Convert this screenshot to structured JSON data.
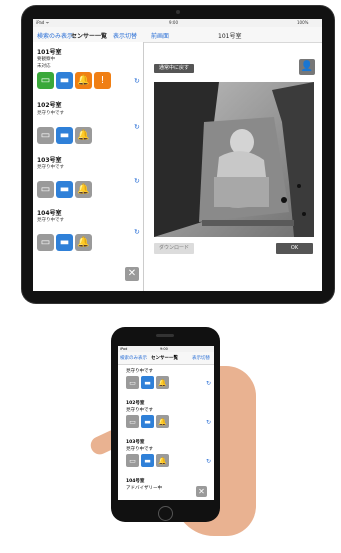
{
  "tablet": {
    "status_left": "iPad ᯤ",
    "status_time": "9:00",
    "status_right": "100%",
    "nav_left": "検索のみ表示",
    "nav_center": "センサー一覧",
    "nav_right": "表示切替",
    "nav_right2": "前画面",
    "detail_title": "101号室",
    "rooms": [
      {
        "name": "101号室",
        "line1": "要観察中",
        "line2": "未対応"
      },
      {
        "name": "102号室",
        "line1": "見守り中です"
      },
      {
        "name": "103号室",
        "line1": "見守り中です"
      },
      {
        "name": "104号室",
        "line1": "見守り中です"
      }
    ],
    "top_button": "通常中に戻す",
    "bottom_left_button": "ダウンロード",
    "bottom_right_button": "OK",
    "icons": {
      "bed": "bed-icon",
      "monitor": "monitor-icon",
      "bell": "bell-icon",
      "person": "person-icon",
      "tools": "tools-icon",
      "calendar": "calendar-icon"
    }
  },
  "phone": {
    "status_left": "iPod",
    "status_time": "9:00",
    "nav_left": "検索のみ表示",
    "nav_center": "センサー一覧",
    "nav_right": "表示切替",
    "sections": [
      {
        "sub": "見守り中です"
      },
      {
        "name": "102号室",
        "sub": "見守り中です"
      },
      {
        "name": "103号室",
        "sub": "見守り中です"
      },
      {
        "name": "104号室",
        "sub": "アドバイザリー中"
      }
    ]
  }
}
